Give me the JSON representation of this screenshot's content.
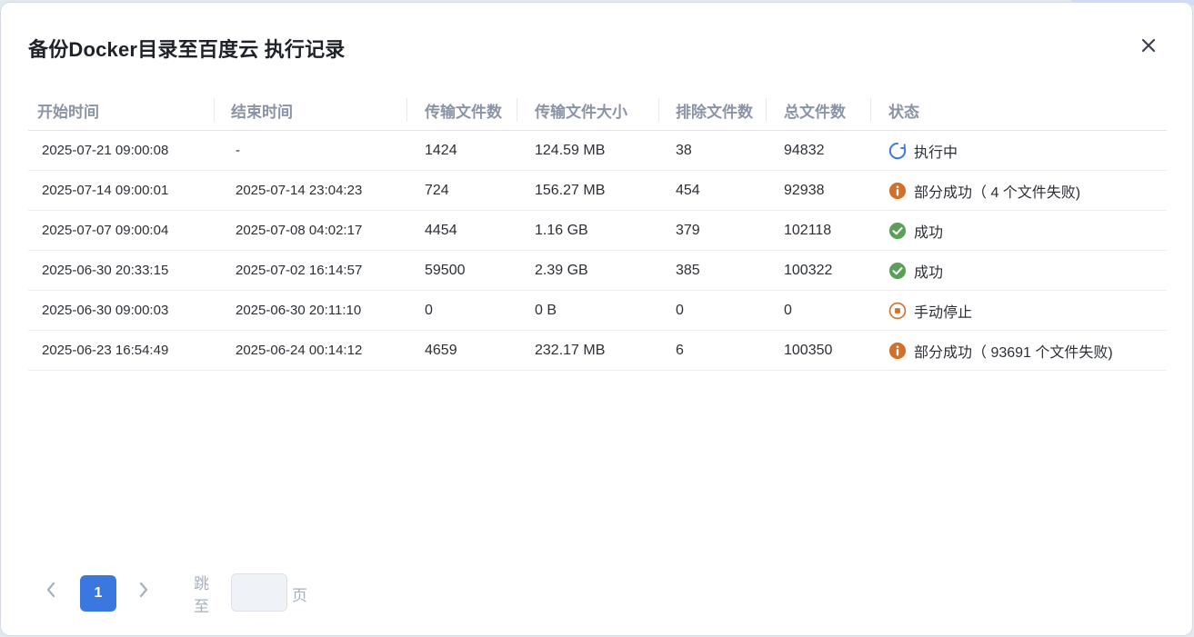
{
  "dialog": {
    "title": "备份Docker目录至百度云 执行记录",
    "close_icon": "close-icon"
  },
  "table": {
    "headers": [
      "开始时间",
      "结束时间",
      "传输文件数",
      "传输文件大小",
      "排除文件数",
      "总文件数",
      "状态"
    ],
    "rows": [
      {
        "start": "2025-07-21 09:00:08",
        "end": "-",
        "files": "1424",
        "size": "124.59 MB",
        "excluded": "38",
        "total": "94832",
        "status": "执行中",
        "status_icon": "running-spinner-icon"
      },
      {
        "start": "2025-07-14 09:00:01",
        "end": "2025-07-14 23:04:23",
        "files": "724",
        "size": "156.27 MB",
        "excluded": "454",
        "total": "92938",
        "status": "部分成功（ 4 个文件失败)",
        "status_icon": "info-warning-icon"
      },
      {
        "start": "2025-07-07 09:00:04",
        "end": "2025-07-08 04:02:17",
        "files": "4454",
        "size": "1.16 GB",
        "excluded": "379",
        "total": "102118",
        "status": "成功",
        "status_icon": "success-check-icon"
      },
      {
        "start": "2025-06-30 20:33:15",
        "end": "2025-07-02 16:14:57",
        "files": "59500",
        "size": "2.39 GB",
        "excluded": "385",
        "total": "100322",
        "status": "成功",
        "status_icon": "success-check-icon"
      },
      {
        "start": "2025-06-30 09:00:03",
        "end": "2025-06-30 20:11:10",
        "files": "0",
        "size": "0 B",
        "excluded": "0",
        "total": "0",
        "status": "手动停止",
        "status_icon": "stop-icon"
      },
      {
        "start": "2025-06-23 16:54:49",
        "end": "2025-06-24 00:14:12",
        "files": "4659",
        "size": "232.17 MB",
        "excluded": "6",
        "total": "100350",
        "status": "部分成功（ 93691 个文件失败)",
        "status_icon": "info-warning-icon"
      }
    ]
  },
  "pagination": {
    "current_page": "1",
    "jump_label": "跳至",
    "page_suffix": "页",
    "jump_value": ""
  },
  "colors": {
    "accent": "#3a78e0",
    "running": "#3a78e0",
    "warning": "#d2702b",
    "success": "#5aa05a",
    "stopped": "#d2702b"
  }
}
